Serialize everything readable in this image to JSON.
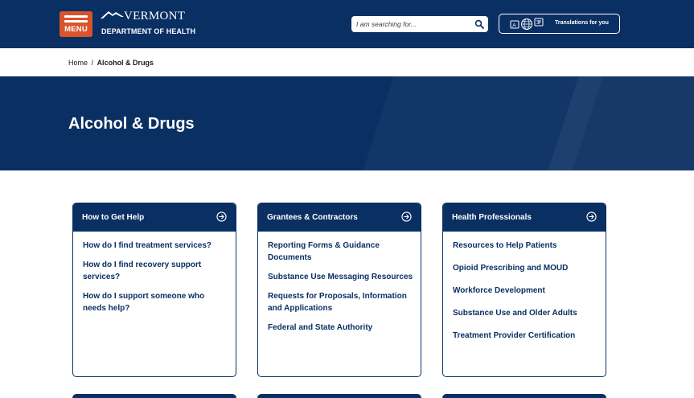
{
  "header": {
    "menu_label": "MENU",
    "logo_state": "VERMONT",
    "logo_department": "DEPARTMENT OF HEALTH",
    "search_placeholder": "I am searching for...",
    "translate_label": "Translations for you"
  },
  "breadcrumb": {
    "home": "Home",
    "separator": "/",
    "current": "Alcohol & Drugs"
  },
  "hero": {
    "title": "Alcohol & Drugs"
  },
  "cards": [
    {
      "title": "How to Get Help",
      "links": [
        "How do I find treatment services?",
        "How do I find recovery support services?",
        "How do I support someone who needs help?"
      ]
    },
    {
      "title": "Grantees & Contractors",
      "links": [
        "Reporting Forms & Guidance Documents",
        "Substance Use Messaging Resources",
        "Requests for Proposals, Information and Applications",
        "Federal and State Authority"
      ]
    },
    {
      "title": "Health Professionals",
      "links": [
        "Resources to Help Patients",
        "Opioid Prescribing and MOUD",
        "Workforce Development",
        "Substance Use and Older Adults",
        "Treatment Provider Certification"
      ]
    }
  ],
  "colors": {
    "navy": "#0a2f63",
    "menu_orange": "#d9542b",
    "white": "#ffffff"
  },
  "icons": {
    "search": "search-icon",
    "translate": "translate-icon",
    "card_arrow": "arrow-circle-right-icon"
  }
}
